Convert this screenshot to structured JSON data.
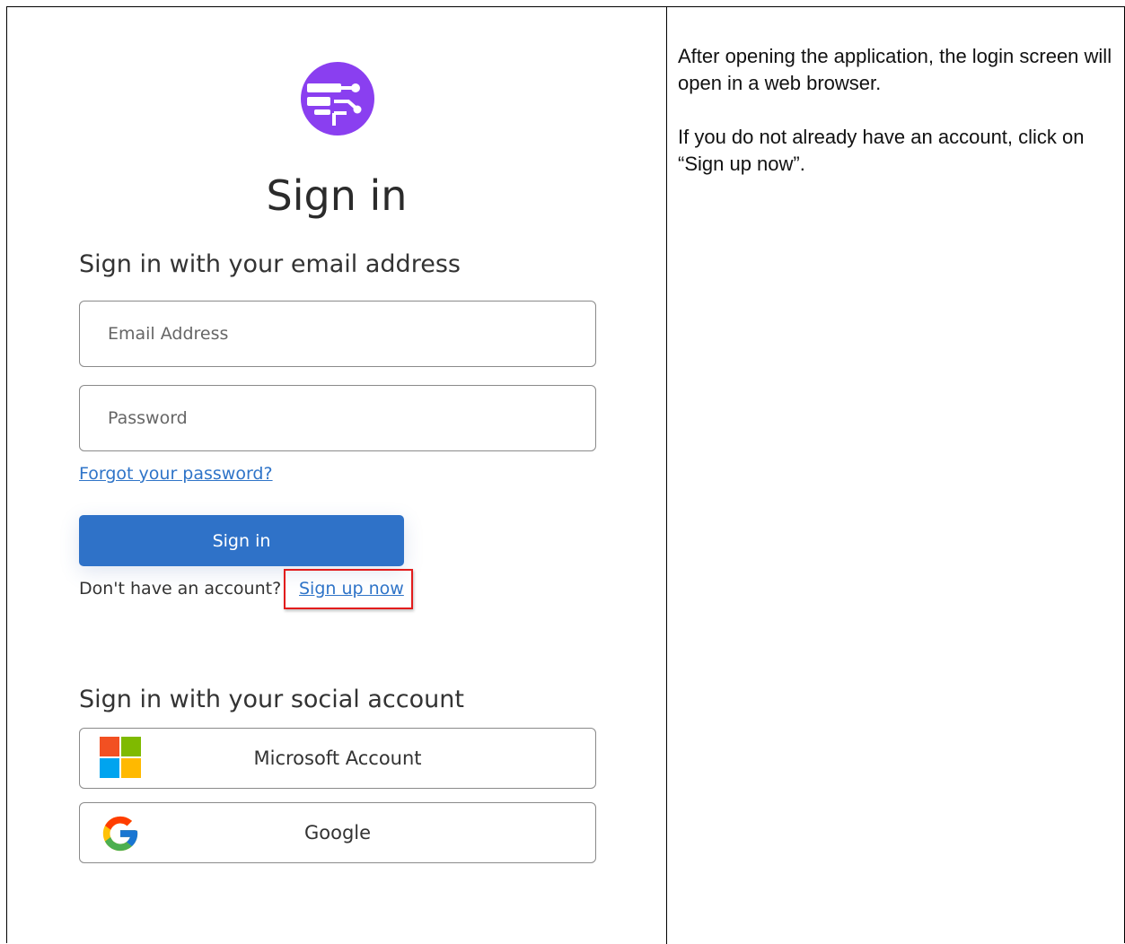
{
  "login": {
    "logo_icon": "app-logo-icon",
    "title": "Sign in",
    "email_section_heading": "Sign in with your email address",
    "email_placeholder": "Email Address",
    "password_placeholder": "Password",
    "forgot_password_label": "Forgot your password?",
    "signin_button_label": "Sign in",
    "no_account_text": "Don't have an account?",
    "signup_link_label": "Sign up now",
    "social_section_heading": "Sign in with your social account",
    "social_buttons": [
      {
        "label": "Microsoft Account",
        "icon": "microsoft-icon"
      },
      {
        "label": "Google",
        "icon": "google-icon"
      }
    ],
    "colors": {
      "accent": "#2f72c8",
      "logo_purple": "#8a3ff0",
      "highlight_box": "#e21c1c"
    }
  },
  "instructions": {
    "paragraphs": [
      "After opening the application, the login screen will open in a web browser.",
      "If you do not already have an account, click on “Sign up now”."
    ]
  }
}
